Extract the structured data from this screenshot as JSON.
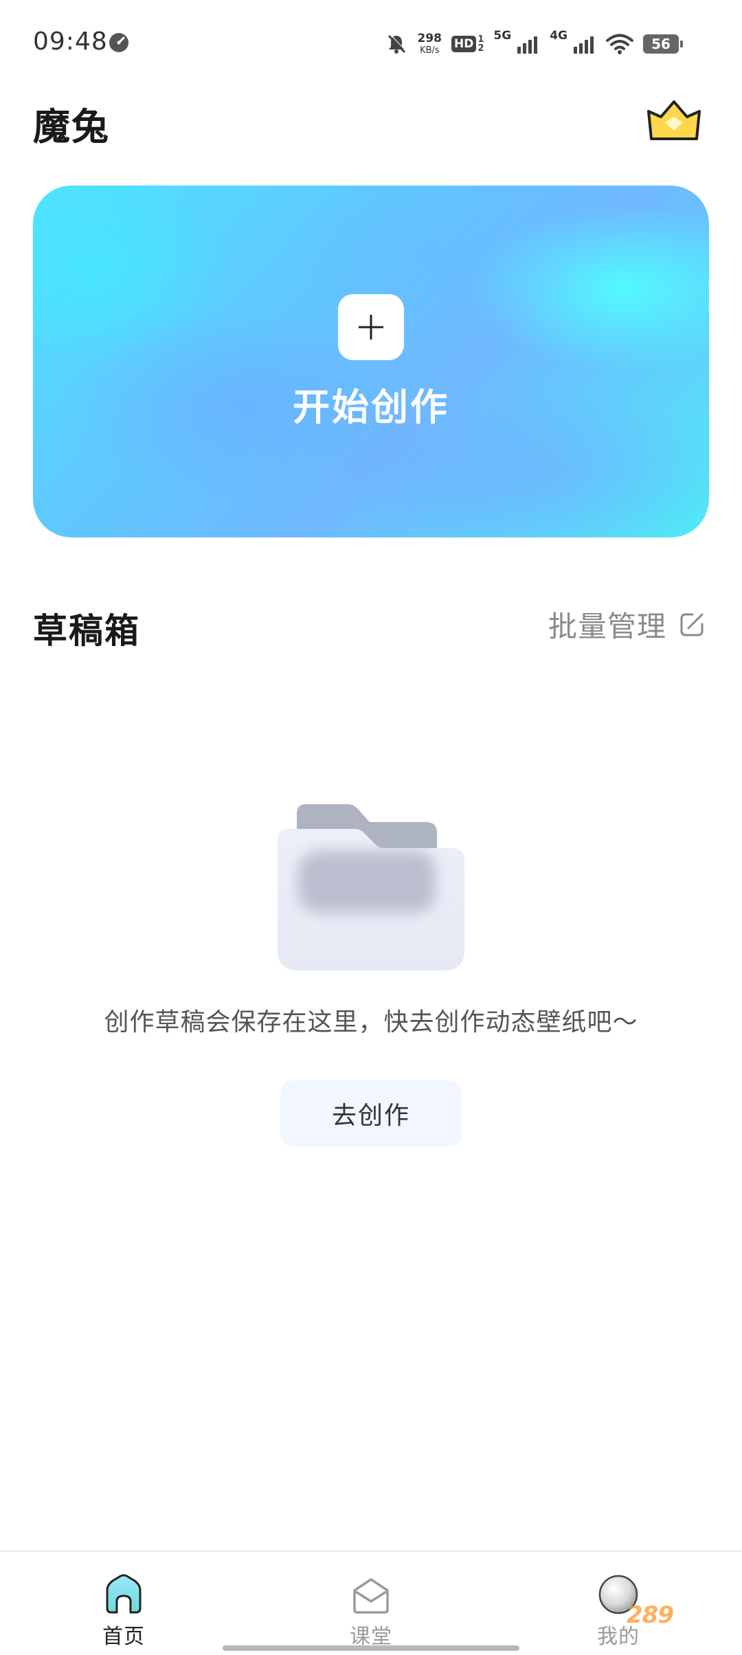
{
  "status_bar": {
    "time": "09:48",
    "net_speed_value": "298",
    "net_speed_unit": "KB/s",
    "hd_label": "HD",
    "sim_label_1": "5G",
    "sim_label_2": "4G",
    "battery_level": "56"
  },
  "header": {
    "title": "魔兔"
  },
  "banner": {
    "label": "开始创作"
  },
  "drafts": {
    "title": "草稿箱",
    "batch_manage_label": "批量管理",
    "empty_message": "创作草稿会保存在这里，快去创作动态壁纸吧～",
    "go_create_label": "去创作"
  },
  "bottom_nav": {
    "items": [
      {
        "label": "首页",
        "icon": "home-icon",
        "active": true
      },
      {
        "label": "课堂",
        "icon": "classroom-icon",
        "active": false
      },
      {
        "label": "我的",
        "icon": "profile-avatar-icon",
        "active": false
      }
    ]
  },
  "watermark": {
    "text": "289"
  },
  "colors": {
    "banner_cyan": "#4fe3ff",
    "banner_blue": "#6fb8ff",
    "vip_gold": "#ffd84a",
    "button_bg": "#f2f6ff",
    "inactive_nav": "#9a9a9a"
  }
}
